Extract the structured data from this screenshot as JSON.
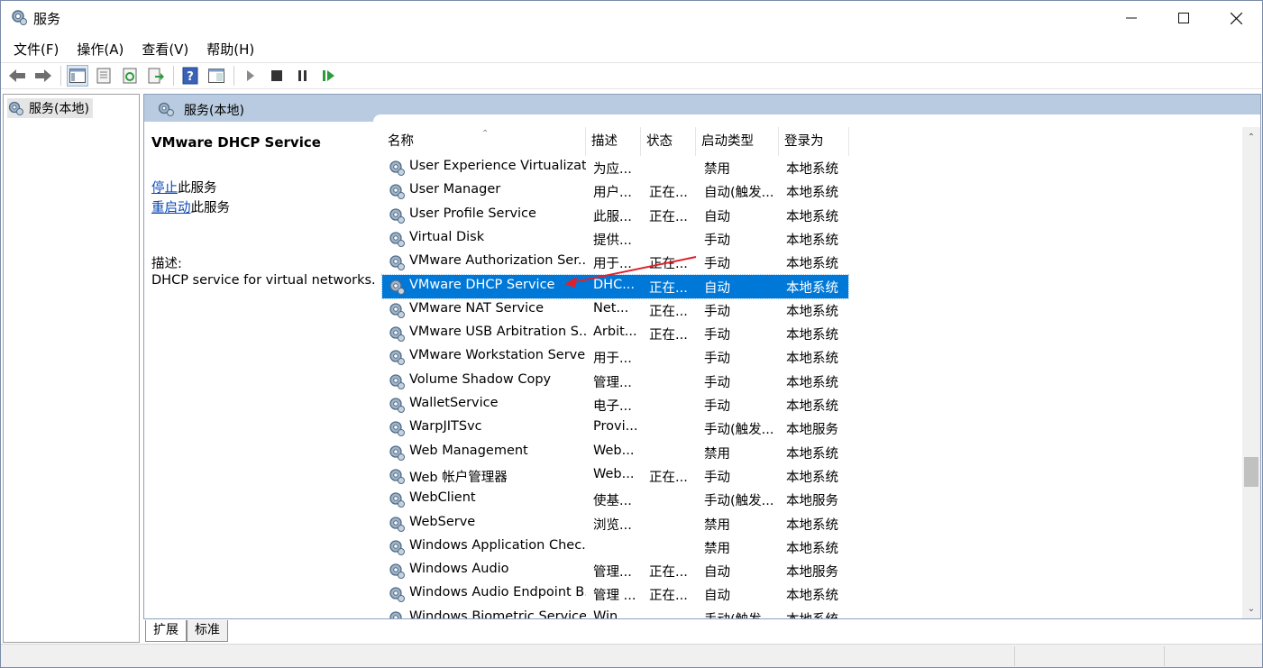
{
  "window": {
    "title": "服务"
  },
  "menu": [
    "文件(F)",
    "操作(A)",
    "查看(V)",
    "帮助(H)"
  ],
  "toolbar": {
    "icons": [
      "back-arrow-icon",
      "forward-arrow-icon",
      "console-tree-icon",
      "properties-icon",
      "refresh-icon",
      "export-list-icon",
      "help-icon",
      "view-pane-icon",
      "start-service-icon",
      "stop-service-icon",
      "pause-service-icon",
      "restart-service-icon"
    ]
  },
  "tree": {
    "root_label": "服务(本地)"
  },
  "main": {
    "header": "服务(本地)",
    "selected_service_title": "VMware DHCP Service",
    "stop_link": "停止",
    "stop_suffix": "此服务",
    "restart_link": "重启动",
    "restart_suffix": "此服务",
    "desc_label": "描述:",
    "desc_text": "DHCP service for virtual networks."
  },
  "columns": {
    "name": "名称",
    "desc": "描述",
    "status": "状态",
    "startup": "启动类型",
    "logon": "登录为"
  },
  "rows": [
    {
      "name": "User Experience Virtualizat...",
      "desc": "为应...",
      "status": "",
      "startup": "禁用",
      "logon": "本地系统"
    },
    {
      "name": "User Manager",
      "desc": "用户...",
      "status": "正在...",
      "startup": "自动(触发...",
      "logon": "本地系统"
    },
    {
      "name": "User Profile Service",
      "desc": "此服...",
      "status": "正在...",
      "startup": "自动",
      "logon": "本地系统"
    },
    {
      "name": "Virtual Disk",
      "desc": "提供...",
      "status": "",
      "startup": "手动",
      "logon": "本地系统"
    },
    {
      "name": "VMware Authorization Ser...",
      "desc": "用于...",
      "status": "正在...",
      "startup": "手动",
      "logon": "本地系统"
    },
    {
      "name": "VMware DHCP Service",
      "desc": "DHC...",
      "status": "正在...",
      "startup": "自动",
      "logon": "本地系统",
      "selected": true
    },
    {
      "name": "VMware NAT Service",
      "desc": "Net...",
      "status": "正在...",
      "startup": "手动",
      "logon": "本地系统"
    },
    {
      "name": "VMware USB Arbitration S...",
      "desc": "Arbit...",
      "status": "正在...",
      "startup": "手动",
      "logon": "本地系统"
    },
    {
      "name": "VMware Workstation Server",
      "desc": "用于...",
      "status": "",
      "startup": "手动",
      "logon": "本地系统"
    },
    {
      "name": "Volume Shadow Copy",
      "desc": "管理...",
      "status": "",
      "startup": "手动",
      "logon": "本地系统"
    },
    {
      "name": "WalletService",
      "desc": "电子...",
      "status": "",
      "startup": "手动",
      "logon": "本地系统"
    },
    {
      "name": "WarpJITSvc",
      "desc": "Provi...",
      "status": "",
      "startup": "手动(触发...",
      "logon": "本地服务"
    },
    {
      "name": "Web Management",
      "desc": "Web...",
      "status": "",
      "startup": "禁用",
      "logon": "本地系统"
    },
    {
      "name": "Web 帐户管理器",
      "desc": "Web...",
      "status": "正在...",
      "startup": "手动",
      "logon": "本地系统"
    },
    {
      "name": "WebClient",
      "desc": "使基...",
      "status": "",
      "startup": "手动(触发...",
      "logon": "本地服务"
    },
    {
      "name": "WebServe",
      "desc": "浏览...",
      "status": "",
      "startup": "禁用",
      "logon": "本地系统"
    },
    {
      "name": "Windows Application Chec...",
      "desc": "",
      "status": "",
      "startup": "禁用",
      "logon": "本地系统"
    },
    {
      "name": "Windows Audio",
      "desc": "管理...",
      "status": "正在...",
      "startup": "自动",
      "logon": "本地服务"
    },
    {
      "name": "Windows Audio Endpoint B...",
      "desc": "管理 ...",
      "status": "正在...",
      "startup": "自动",
      "logon": "本地系统"
    },
    {
      "name": "Windows Biometric Service",
      "desc": "Win...",
      "status": "",
      "startup": "手动(触发...",
      "logon": "本地系统"
    }
  ],
  "tabs": [
    "扩展",
    "标准"
  ],
  "colors": {
    "selection": "#0078d7",
    "header_band": "#b9cbe0",
    "link": "#0b47b5",
    "annotation_arrow": "#e0202a"
  }
}
